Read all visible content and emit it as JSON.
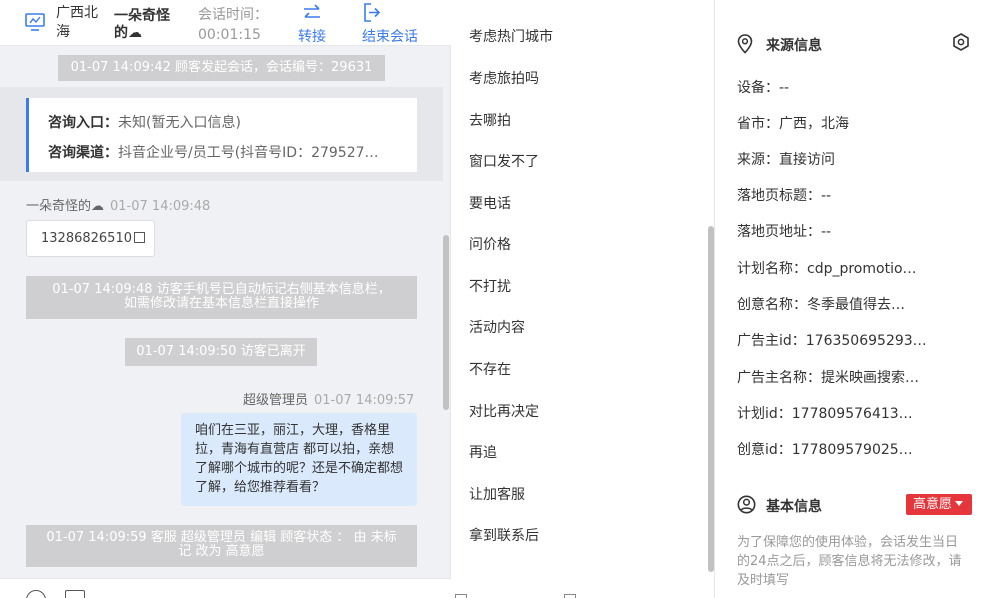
{
  "header": {
    "city": "广西北海",
    "visitor": "一朵奇怪的☁",
    "time_label": "会话时间：",
    "time_value": "00:01:15",
    "transfer": "转接",
    "end": "结束会话"
  },
  "chat": {
    "session_notice": "01-07 14:09:42 顾客发起会话，会话编号：29631",
    "entry_label": "咨询入口：",
    "entry_value": "未知(暂无入口信息)",
    "channel_label": "咨询渠道：",
    "channel_value": "抖音企业号/员工号(抖音号ID：279527…",
    "visitor_name": "一朵奇怪的☁",
    "visitor_time": "01-07 14:09:48",
    "phone": "13286826510",
    "phone_notice_1": "01-07 14:09:48 访客手机号已自动标记右侧基本信息栏，",
    "phone_notice_2": "如需修改请在基本信息栏直接操作",
    "left_notice": "01-07 14:09:50 访客已离开",
    "agent_name": "超级管理员",
    "agent_time": "01-07 14:09:57",
    "agent_message": "咱们在三亚，丽江，大理，香格里拉，青海有直营店 都可以拍，亲想了解哪个城市的呢？还是不确定都想了解，给您推荐看看？",
    "status_notice_1": "01-07 14:09:59 客服 超级管理员 编辑 顾客状态 ： 由 未标",
    "status_notice_2": "记 改为 高意愿"
  },
  "quick_replies": [
    "考虑热门城市",
    "考虑旅拍吗",
    "去哪拍",
    "窗口发不了",
    "要电话",
    "问价格",
    "不打扰",
    "活动内容",
    "不存在",
    "对比再决定",
    "再追",
    "让加客服",
    "拿到联系后"
  ],
  "source": {
    "title": "来源信息",
    "fields": [
      "设备：--",
      "省市：广西，北海",
      "来源：直接访问",
      "落地页标题：--",
      "落地页地址：--",
      "计划名称：cdp_promotio…",
      "创意名称：冬季最值得去…",
      "广告主id：176350695293…",
      "广告主名称：提米映画搜索…",
      "计划id：177809576413…",
      "创意id：177809579025…"
    ]
  },
  "basic": {
    "title": "基本信息",
    "intent": "高意愿",
    "hint": "为了保障您的使用体验，会话发生当日的24点之后，顾客信息将无法修改，请及时填写"
  },
  "colors": {
    "accent": "#3a7cf0",
    "badge": "#e5363c",
    "system_msg": "#cfcfd1",
    "agent_bubble": "#dae9fb"
  }
}
